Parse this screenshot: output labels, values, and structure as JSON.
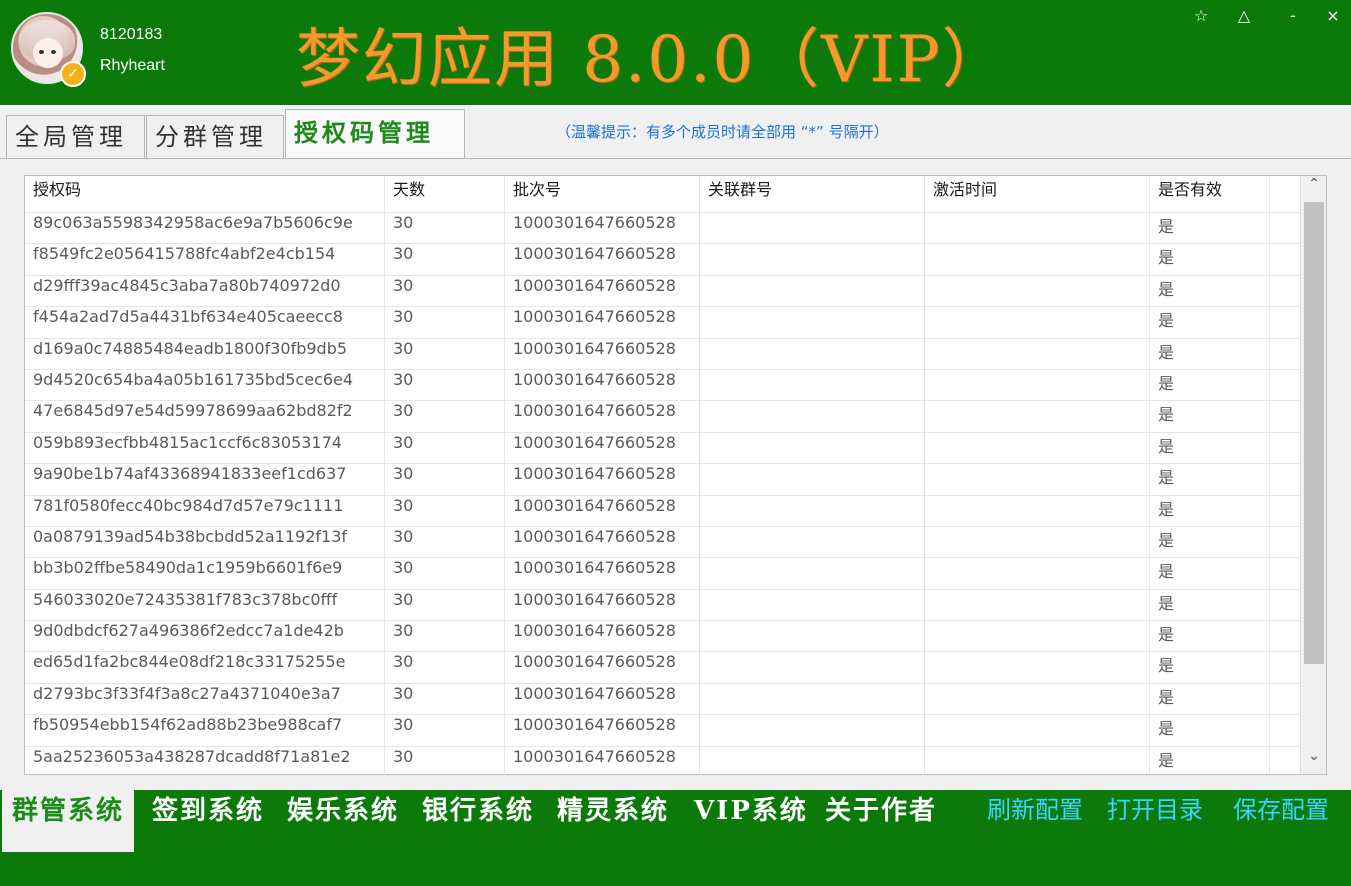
{
  "header": {
    "user_id": "8120183",
    "user_name": "Rhyheart",
    "title": "梦幻应用 8.0.0（VIP）",
    "window_buttons": [
      "☆",
      "△",
      "-",
      "×"
    ]
  },
  "tabs": [
    {
      "label": "全局管理",
      "active": false
    },
    {
      "label": "分群管理",
      "active": false
    },
    {
      "label": "授权码管理",
      "active": true
    }
  ],
  "hint": "（温馨提示：有多个成员时请全部用 “*” 号隔开）",
  "table": {
    "columns": [
      "授权码",
      "天数",
      "批次号",
      "关联群号",
      "激活时间",
      "是否有效"
    ],
    "rows": [
      [
        "89c063a5598342958ac6e9a7b5606c9e",
        "30",
        "1000301647660528",
        "",
        "",
        "是"
      ],
      [
        "f8549fc2e056415788fc4abf2e4cb154",
        "30",
        "1000301647660528",
        "",
        "",
        "是"
      ],
      [
        "d29fff39ac4845c3aba7a80b740972d0",
        "30",
        "1000301647660528",
        "",
        "",
        "是"
      ],
      [
        "f454a2ad7d5a4431bf634e405caeecc8",
        "30",
        "1000301647660528",
        "",
        "",
        "是"
      ],
      [
        "d169a0c74885484eadb1800f30fb9db5",
        "30",
        "1000301647660528",
        "",
        "",
        "是"
      ],
      [
        "9d4520c654ba4a05b161735bd5cec6e4",
        "30",
        "1000301647660528",
        "",
        "",
        "是"
      ],
      [
        "47e6845d97e54d59978699aa62bd82f2",
        "30",
        "1000301647660528",
        "",
        "",
        "是"
      ],
      [
        "059b893ecfbb4815ac1ccf6c83053174",
        "30",
        "1000301647660528",
        "",
        "",
        "是"
      ],
      [
        "9a90be1b74af43368941833eef1cd637",
        "30",
        "1000301647660528",
        "",
        "",
        "是"
      ],
      [
        "781f0580fecc40bc984d7d57e79c1111",
        "30",
        "1000301647660528",
        "",
        "",
        "是"
      ],
      [
        "0a0879139ad54b38bcbdd52a1192f13f",
        "30",
        "1000301647660528",
        "",
        "",
        "是"
      ],
      [
        "bb3b02ffbe58490da1c1959b6601f6e9",
        "30",
        "1000301647660528",
        "",
        "",
        "是"
      ],
      [
        "546033020e72435381f783c378bc0fff",
        "30",
        "1000301647660528",
        "",
        "",
        "是"
      ],
      [
        "9d0dbdcf627a496386f2edcc7a1de42b",
        "30",
        "1000301647660528",
        "",
        "",
        "是"
      ],
      [
        "ed65d1fa2bc844e08df218c33175255e",
        "30",
        "1000301647660528",
        "",
        "",
        "是"
      ],
      [
        "d2793bc3f33f4f3a8c27a4371040e3a7",
        "30",
        "1000301647660528",
        "",
        "",
        "是"
      ],
      [
        "fb50954ebb154f62ad88b23be988caf7",
        "30",
        "1000301647660528",
        "",
        "",
        "是"
      ],
      [
        "5aa25236053a438287dcadd8f71a81e2",
        "30",
        "1000301647660528",
        "",
        "",
        "是"
      ]
    ]
  },
  "bottom_nav": [
    {
      "label": "群管系统",
      "active": true
    },
    {
      "label": "签到系统",
      "active": false
    },
    {
      "label": "娱乐系统",
      "active": false
    },
    {
      "label": "银行系统",
      "active": false
    },
    {
      "label": "精灵系统",
      "active": false
    },
    {
      "label": "VIP系统",
      "active": false
    },
    {
      "label": "关于作者",
      "active": false
    }
  ],
  "actions": [
    "刷新配置",
    "打开目录",
    "保存配置"
  ],
  "colors": {
    "background": "#0b7a0b",
    "title": "#f39a2a",
    "active_tab": "#1c8a1c",
    "hint": "#1a73d9",
    "action": "#3ad4ff"
  }
}
